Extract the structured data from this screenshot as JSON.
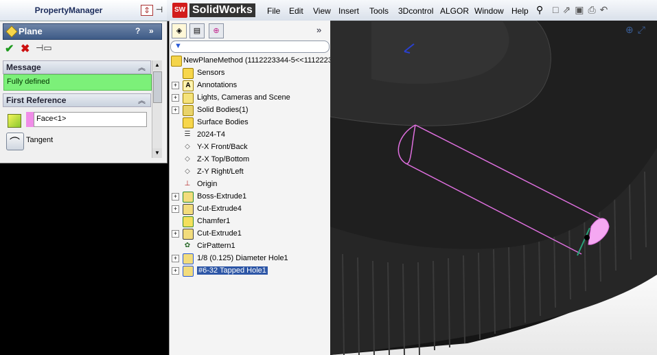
{
  "property_manager": {
    "title": "PropertyManager",
    "feature": "Plane",
    "help": "?",
    "collapse": "»",
    "message_section": "Message",
    "message_text": "Fully defined",
    "first_reference_section": "First Reference",
    "reference_value": "Face<1>",
    "tangent_label": "Tangent"
  },
  "app": {
    "brand": "SolidWorks",
    "logo": "SW",
    "menu": [
      "File",
      "Edit",
      "View",
      "Insert",
      "Tools",
      "3Dcontrol",
      "ALGOR",
      "Window",
      "Help"
    ]
  },
  "tree": {
    "expand_label": "»",
    "root": "NewPlaneMethod  (1112223344-5<<1112223",
    "items": [
      {
        "label": "Sensors",
        "expandable": false,
        "icon": "sensor-icon"
      },
      {
        "label": "Annotations",
        "expandable": true,
        "icon": "annotation-icon"
      },
      {
        "label": "Lights, Cameras and Scene",
        "expandable": true,
        "icon": "lights-icon"
      },
      {
        "label": "Solid Bodies(1)",
        "expandable": true,
        "icon": "solid-bodies-icon"
      },
      {
        "label": "Surface Bodies",
        "expandable": false,
        "icon": "surface-bodies-icon"
      },
      {
        "label": "2024-T4",
        "expandable": false,
        "icon": "material-icon"
      },
      {
        "label": "Y-X Front/Back",
        "expandable": false,
        "icon": "plane-icon"
      },
      {
        "label": "Z-X Top/Bottom",
        "expandable": false,
        "icon": "plane-icon"
      },
      {
        "label": "Z-Y Right/Left",
        "expandable": false,
        "icon": "plane-icon"
      },
      {
        "label": "Origin",
        "expandable": false,
        "icon": "origin-icon"
      },
      {
        "label": "Boss-Extrude1",
        "expandable": true,
        "icon": "extrude-icon"
      },
      {
        "label": "Cut-Extrude4",
        "expandable": true,
        "icon": "cut-icon"
      },
      {
        "label": "Chamfer1",
        "expandable": false,
        "icon": "chamfer-icon"
      },
      {
        "label": "Cut-Extrude1",
        "expandable": true,
        "icon": "cut-icon"
      },
      {
        "label": "CirPattern1",
        "expandable": false,
        "icon": "pattern-icon"
      },
      {
        "label": "1/8 (0.125) Diameter Hole1",
        "expandable": true,
        "icon": "hole-icon"
      },
      {
        "label": "#6-32 Tapped Hole1",
        "expandable": true,
        "icon": "hole-icon",
        "selected": true
      }
    ]
  },
  "colors": {
    "message_ok": "#7cf079",
    "selection": "#2d56a6",
    "sketch": "#e070e0"
  }
}
